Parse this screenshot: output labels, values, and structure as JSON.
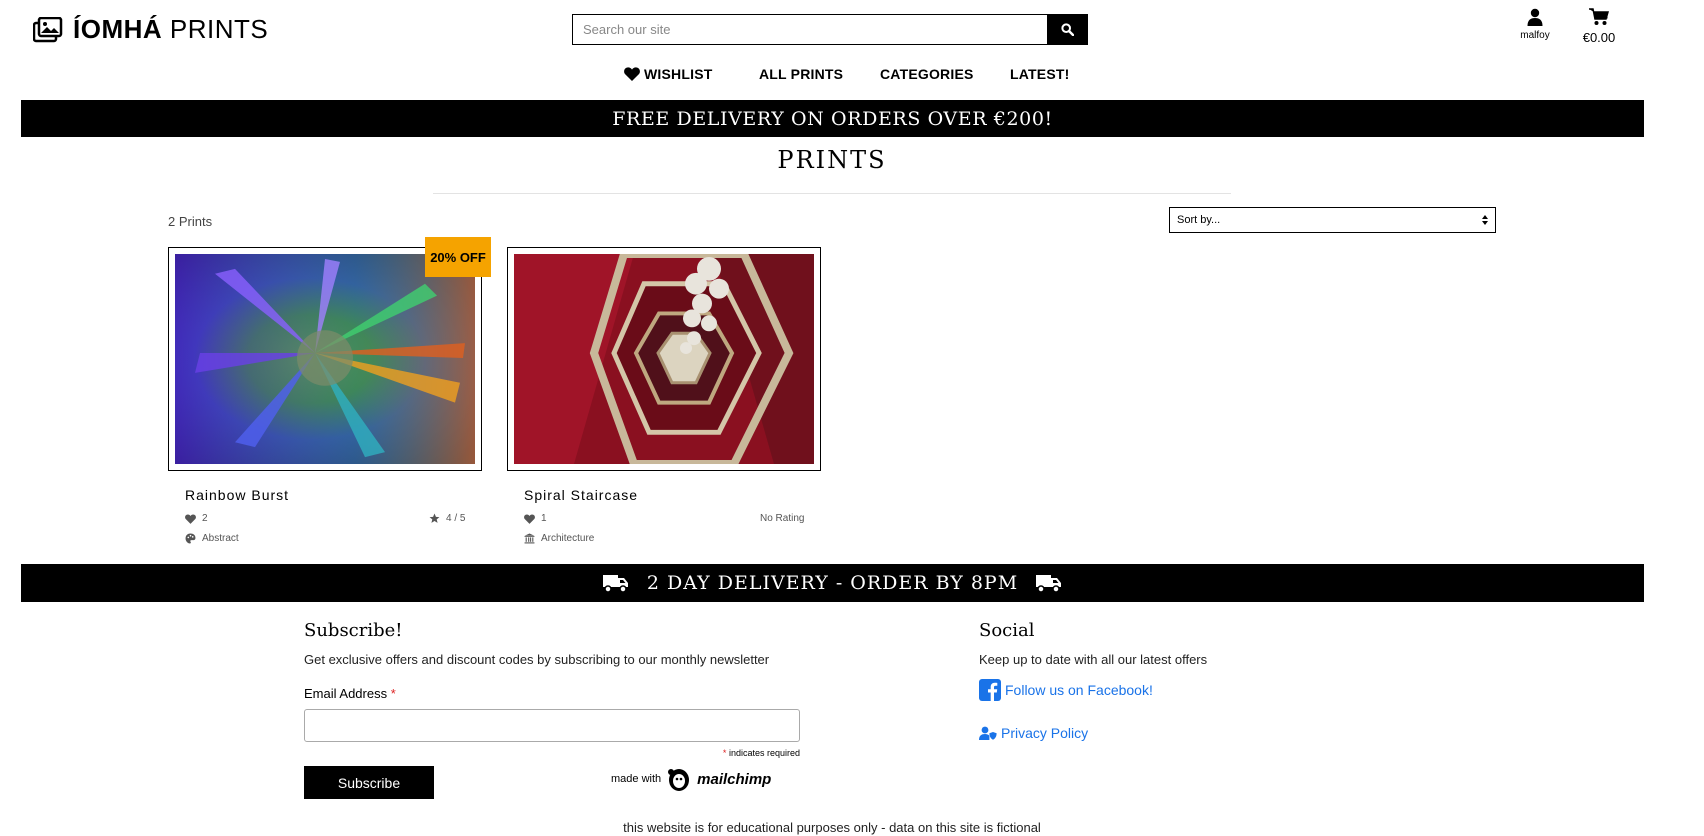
{
  "header": {
    "logo_bold": "ÍOMHÁ",
    "logo_light": "PRINTS",
    "search_placeholder": "Search our site",
    "account_label": "malfoy",
    "cart_total": "€0.00"
  },
  "nav": {
    "items": [
      {
        "label": "WISHLIST",
        "icon": "heart-icon"
      },
      {
        "label": "ALL PRINTS"
      },
      {
        "label": "CATEGORIES"
      },
      {
        "label": "LATEST!"
      }
    ]
  },
  "banners": {
    "top": "FREE DELIVERY ON ORDERS OVER €200!",
    "middle": "2 DAY DELIVERY - ORDER BY 8PM"
  },
  "page": {
    "title": "PRINTS",
    "count": "2 Prints",
    "sort_label": "Sort by..."
  },
  "products": [
    {
      "title": "Rainbow Burst",
      "badge": "20% OFF",
      "likes": "2",
      "rating": "4 / 5",
      "category": "Abstract"
    },
    {
      "title": "Spiral Staircase",
      "badge": "",
      "likes": "1",
      "rating": "No Rating",
      "category": "Architecture"
    }
  ],
  "footer": {
    "subscribe_heading": "Subscribe!",
    "subscribe_text": "Get exclusive offers and discount codes by subscribing to our monthly newsletter",
    "email_label": "Email Address",
    "required_mark": "*",
    "required_note": "indicates required",
    "subscribe_button": "Subscribe",
    "mailchimp_prefix": "made with",
    "mailchimp_logo": "mailchimp",
    "social_heading": "Social",
    "social_text": "Keep up to date with all our latest offers",
    "facebook_link": "Follow us on Facebook!",
    "privacy_link": "Privacy Policy",
    "disclaimer": "this website is for educational purposes only - data on this site is fictional"
  },
  "colors": {
    "badge": "#f5a300",
    "link": "#1a73e8",
    "banner_bg": "#000000"
  }
}
